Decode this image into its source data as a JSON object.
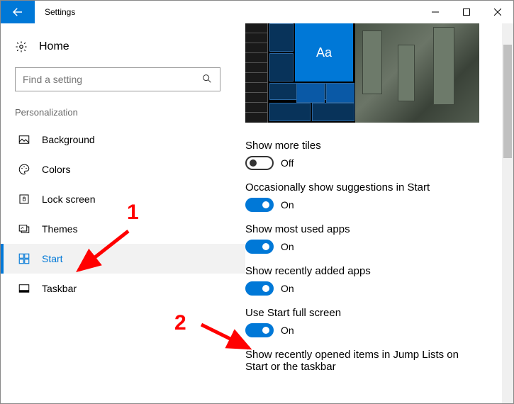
{
  "window": {
    "title": "Settings"
  },
  "sidebar": {
    "home_label": "Home",
    "search_placeholder": "Find a setting",
    "section_header": "Personalization",
    "items": [
      {
        "label": "Background"
      },
      {
        "label": "Colors"
      },
      {
        "label": "Lock screen"
      },
      {
        "label": "Themes"
      },
      {
        "label": "Start"
      },
      {
        "label": "Taskbar"
      }
    ]
  },
  "preview": {
    "sample_text": "Aa"
  },
  "settings": [
    {
      "label": "Show more tiles",
      "state": "Off",
      "on": false
    },
    {
      "label": "Occasionally show suggestions in Start",
      "state": "On",
      "on": true
    },
    {
      "label": "Show most used apps",
      "state": "On",
      "on": true
    },
    {
      "label": "Show recently added apps",
      "state": "On",
      "on": true
    },
    {
      "label": "Use Start full screen",
      "state": "On",
      "on": true
    },
    {
      "label": "Show recently opened items in Jump Lists on Start or the taskbar",
      "state": "",
      "on": null
    }
  ],
  "annotations": {
    "one": "1",
    "two": "2"
  }
}
